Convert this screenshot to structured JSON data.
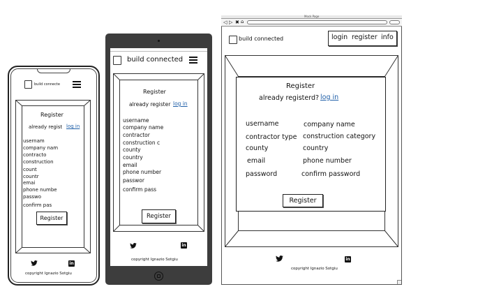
{
  "brand": {
    "title": "build connected",
    "title_phone": "build connecte"
  },
  "nav": {
    "login": "login",
    "register": "register",
    "info": "info"
  },
  "browser": {
    "window_title": "Mock Page"
  },
  "form": {
    "heading": "Register",
    "already_full": "already registerd?",
    "already_tablet": "already register",
    "already_phone": "already regist",
    "login_link": "log in",
    "submit": "Register"
  },
  "fields_desktop": {
    "username": "username",
    "company_name": "company name",
    "contractor_type": "contractor type",
    "construction_category": "construction category",
    "county": "county",
    "country": "country",
    "email": "email",
    "phone_number": "phone number",
    "password": "password",
    "confirm_password": "confirm password"
  },
  "fields_tablet": [
    "username",
    "company name",
    "contractor",
    "construction c",
    "county",
    "country",
    "email",
    "phone number",
    "passwor",
    "confirm pass"
  ],
  "fields_phone": [
    "usernam",
    "company nam",
    "contracto",
    "construction",
    "count",
    "countr",
    "emai",
    "phone numbe",
    "passwo",
    "confirm pas"
  ],
  "footer": {
    "copyright": "copyright Ignazio Sotgiu",
    "icons": [
      "twitter-icon",
      "linkedin-icon"
    ]
  }
}
